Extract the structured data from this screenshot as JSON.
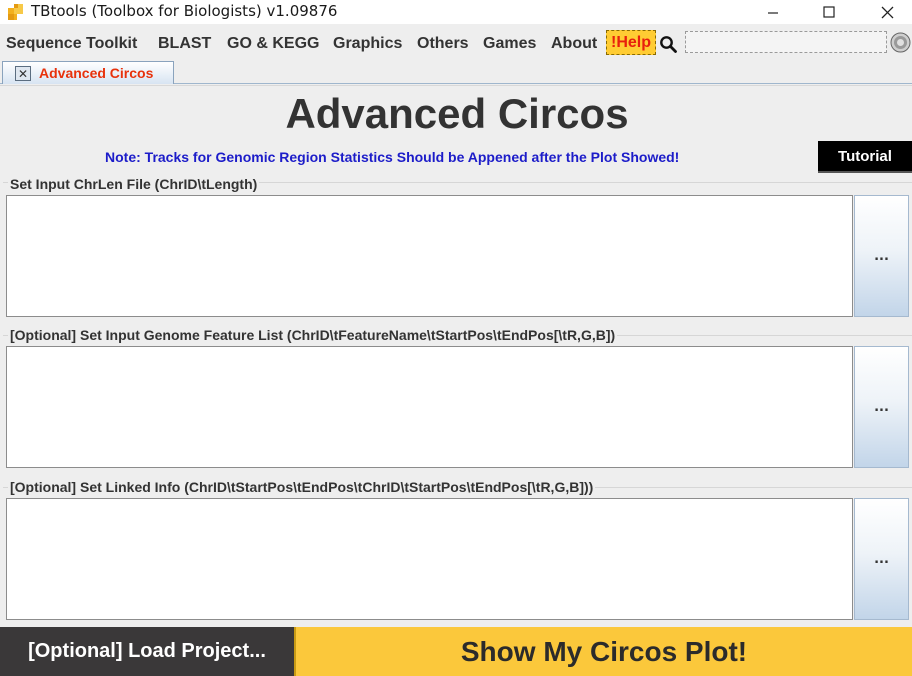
{
  "window": {
    "title": "TBtools (Toolbox for Biologists) v1.09876",
    "minimize_glyph": "—",
    "maximize_glyph": "☐",
    "close_glyph": "✕"
  },
  "menu": {
    "items": [
      "Sequence Toolkit",
      "BLAST",
      "GO & KEGG",
      "Graphics",
      "Others",
      "Games",
      "About"
    ],
    "help_label": "!Help",
    "search_value": ""
  },
  "tab": {
    "label": "Advanced Circos",
    "close_glyph": "✕"
  },
  "main": {
    "title": "Advanced Circos",
    "note": "Note: Tracks for Genomic Region Statistics Should be Appened after the Plot Showed!",
    "tutorial_label": "Tutorial",
    "sections": [
      {
        "label": "Set Input ChrLen File (ChrID\\tLength)",
        "value": "",
        "browse_label": "..."
      },
      {
        "label": "[Optional] Set Input Genome Feature List (ChrID\\tFeatureName\\tStartPos\\tEndPos[\\tR,G,B])",
        "value": "",
        "browse_label": "..."
      },
      {
        "label": "[Optional] Set Linked Info (ChrID\\tStartPos\\tEndPos\\tChrID\\tStartPos\\tEndPos[\\tR,G,B]))",
        "value": "",
        "browse_label": "..."
      }
    ]
  },
  "footer": {
    "load_label": "[Optional] Load Project...",
    "show_label": "Show My Circos Plot!"
  },
  "colors": {
    "accent_yellow": "#fbc83b",
    "help_text": "#e8200c",
    "note_blue": "#1c1cc9",
    "tab_label": "#e8320c",
    "dark_button": "#3a3839"
  },
  "icons": {
    "app": "tbtools-app-icon",
    "search": "search-icon",
    "spinner": "loading-spinner-icon",
    "tab_close": "close-icon"
  }
}
